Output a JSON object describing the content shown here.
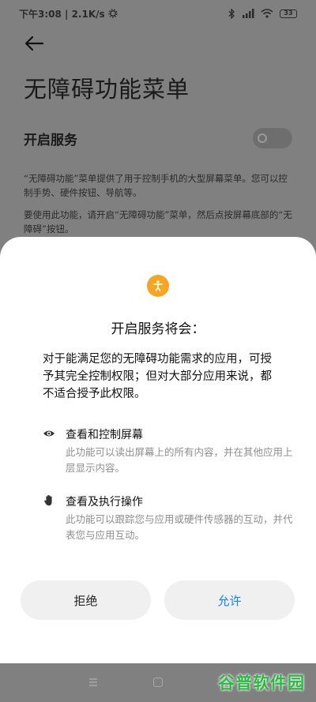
{
  "status_bar": {
    "time_speed": "下午3:08 | 2.1K/s",
    "battery": "33"
  },
  "settings_page": {
    "title": "无障碍功能菜单",
    "service_label": "开启服务",
    "toggle_on": false,
    "description_1": "“无障碍功能”菜单提供了用于控制手机的大型屏幕菜单。您可以控制手势、硬件按钮、导航等。",
    "description_2": "要使用此功能，请开启“无障碍功能”菜单，然后点按屏幕底部的“无障碍”按钮。"
  },
  "dialog": {
    "title": "开启服务将会：",
    "intro": "对于能满足您的无障碍功能需求的应用，可授予其完全控制权限；但对大部分应用来说，都不适合授予此权限。",
    "permissions": [
      {
        "icon": "eye-icon",
        "title": "查看和控制屏幕",
        "description": "此功能可以读出屏幕上的所有内容，并在其他应用上层显示内容。"
      },
      {
        "icon": "hand-icon",
        "title": "查看及执行操作",
        "description": "此功能可以跟踪您与应用或硬件传感器的互动，并代表您与应用互动。"
      }
    ],
    "deny_label": "拒绝",
    "allow_label": "允许",
    "accent_color": "#0d84ff",
    "icon_color": "#f5a623"
  },
  "watermark": "谷普软件园"
}
